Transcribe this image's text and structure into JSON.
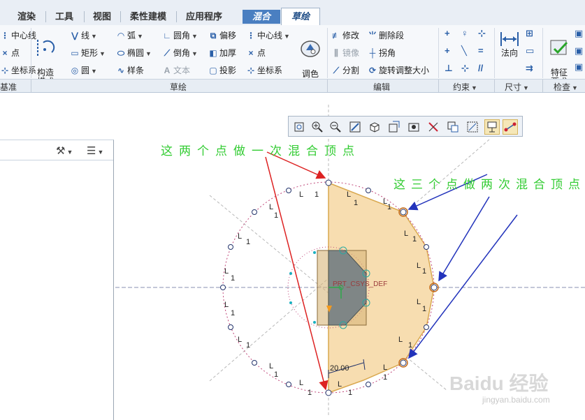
{
  "tabs": [
    {
      "label": "渲染"
    },
    {
      "label": "工具"
    },
    {
      "label": "视图"
    },
    {
      "label": "柔性建模"
    },
    {
      "label": "应用程序"
    }
  ],
  "context_tab": {
    "label": "混合"
  },
  "active_tab": {
    "label": "草绘"
  },
  "ribbon": {
    "datum": {
      "centerline": "中心线",
      "point": "点",
      "csys": "坐标系",
      "group": "基准"
    },
    "construction_mode": "构造\n模式",
    "sketch": {
      "line": "线",
      "rect": "矩形",
      "circle": "圆",
      "arc": "弧",
      "ellipse": "椭圆",
      "spline": "样条",
      "fillet": "圆角",
      "chamfer": "倒角",
      "text": "文本",
      "offset": "偏移",
      "thicken": "加厚",
      "project": "投影",
      "centerline": "中心线",
      "point": "点",
      "csys": "坐标系",
      "palette": "调色\n板",
      "group": "草绘"
    },
    "edit": {
      "modify": "修改",
      "delete_segment": "删除段",
      "mirror": "镜像",
      "corner": "拐角",
      "divide": "分割",
      "rotate_resize": "旋转调整大小",
      "group": "编辑"
    },
    "constrain": {
      "group": "约束"
    },
    "dimension": {
      "normal": "法向",
      "group": "尺寸"
    },
    "inspect": {
      "feature_req": "特征\n要求",
      "group": "检查"
    }
  },
  "canvas": {
    "csys_label": "PRT_CSYS_DEF",
    "dimension_value": "20.00",
    "annotation_1": "这两个点做一次混合顶点",
    "annotation_2": "这三个点做两次混合顶点",
    "watermark": "Baidu 经验",
    "watermark_url": "jingyan.baidu.com"
  },
  "colors": {
    "accent": "#4a7fc1",
    "fill": "#f7ddb0",
    "annotation": "#33cc33",
    "arrow_red": "#dd2222",
    "arrow_blue": "#2233bb"
  }
}
